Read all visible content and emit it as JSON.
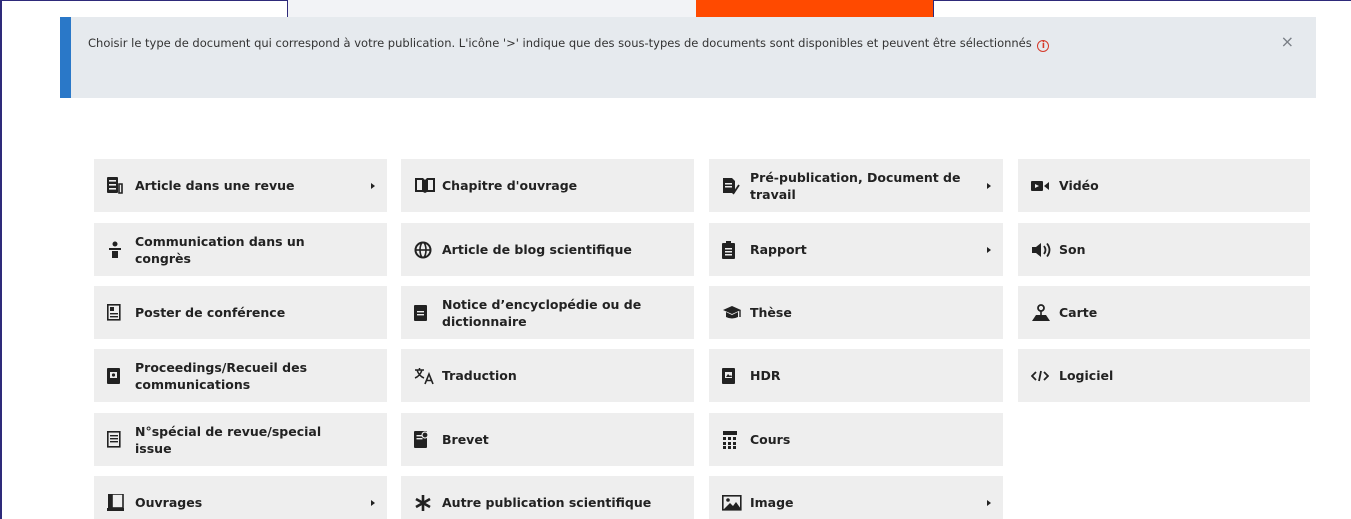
{
  "alert": {
    "text": "Choisir le type de document qui correspond à votre publication. L'icône '>' indique que des sous-types de documents sont disponibles et peuvent être sélectionnés",
    "info_glyph": "i",
    "close_glyph": "×"
  },
  "colors": {
    "accent_orange": "#ff4a00",
    "alert_border": "#2a78c8",
    "info_red": "#d53a2a"
  },
  "doc_types": [
    {
      "label": "Article dans une revue",
      "icon": "article-icon",
      "has_subtypes": true
    },
    {
      "label": "Chapitre d'ouvrage",
      "icon": "open-book-icon",
      "has_subtypes": false
    },
    {
      "label": "Pré-publication, Document de travail",
      "icon": "draft-document-icon",
      "has_subtypes": true
    },
    {
      "label": "Vidéo",
      "icon": "video-camera-icon",
      "has_subtypes": false
    },
    {
      "label": "Communication dans un congrès",
      "icon": "lectern-speaker-icon",
      "has_subtypes": false
    },
    {
      "label": "Article de blog scientifique",
      "icon": "globe-icon",
      "has_subtypes": false
    },
    {
      "label": "Rapport",
      "icon": "clipboard-report-icon",
      "has_subtypes": true
    },
    {
      "label": "Son",
      "icon": "speaker-sound-icon",
      "has_subtypes": false
    },
    {
      "label": "Poster de conférence",
      "icon": "poster-icon",
      "has_subtypes": false
    },
    {
      "label": "Notice d’encyclopédie ou de dictionnaire",
      "icon": "encyclopedia-icon",
      "has_subtypes": false
    },
    {
      "label": "Thèse",
      "icon": "graduation-cap-icon",
      "has_subtypes": false
    },
    {
      "label": "Carte",
      "icon": "map-pin-icon",
      "has_subtypes": false
    },
    {
      "label": "Proceedings/Recueil des communications",
      "icon": "proceedings-icon",
      "has_subtypes": false
    },
    {
      "label": "Traduction",
      "icon": "translate-icon",
      "has_subtypes": false
    },
    {
      "label": "HDR",
      "icon": "hdr-document-icon",
      "has_subtypes": false
    },
    {
      "label": "Logiciel",
      "icon": "code-icon",
      "has_subtypes": false
    },
    {
      "label": "N°spécial de revue/special issue",
      "icon": "special-issue-icon",
      "has_subtypes": false
    },
    {
      "label": "Brevet",
      "icon": "patent-certificate-icon",
      "has_subtypes": false
    },
    {
      "label": "Cours",
      "icon": "course-grid-icon",
      "has_subtypes": false
    },
    {
      "label": "Ouvrages",
      "icon": "book-icon",
      "has_subtypes": true
    },
    {
      "label": "Autre publication scientifique",
      "icon": "asterisk-icon",
      "has_subtypes": false
    },
    {
      "label": "Image",
      "icon": "image-icon",
      "has_subtypes": true
    }
  ]
}
